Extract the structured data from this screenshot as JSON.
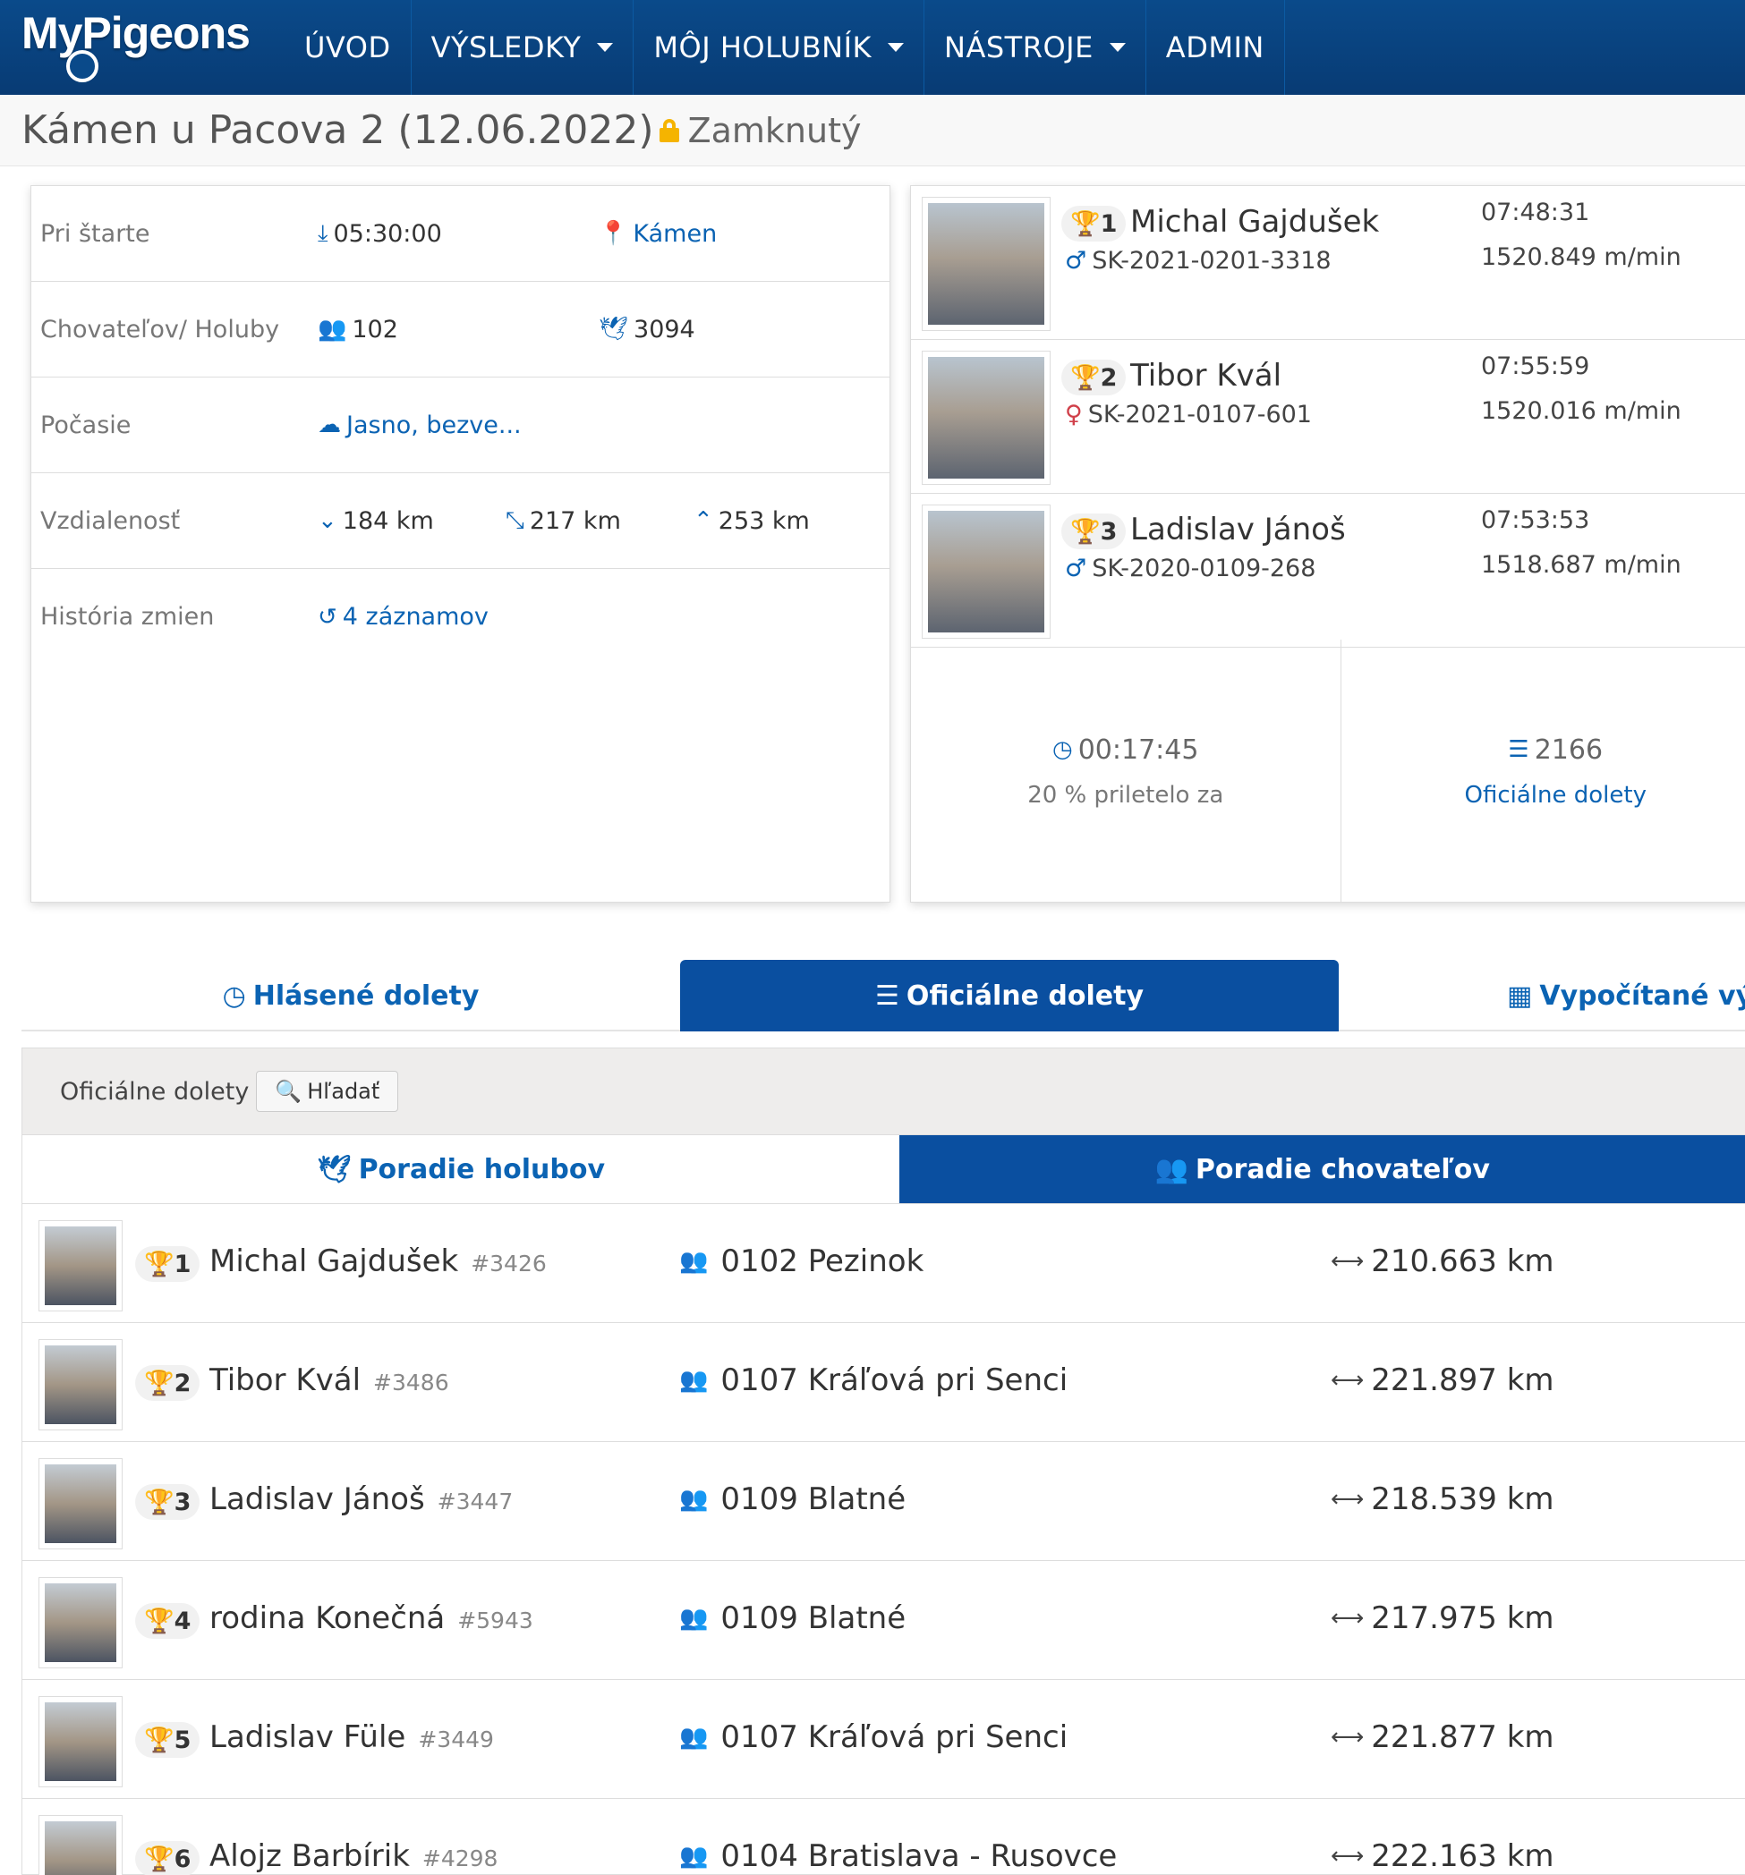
{
  "brand": {
    "logo_text": "MyPigeons"
  },
  "nav": {
    "items": [
      {
        "label": "ÚVOD"
      },
      {
        "label": "VÝSLEDKY"
      },
      {
        "label": "MÔJ HOLUBNÍK"
      },
      {
        "label": "NÁSTROJE"
      },
      {
        "label": "ADMIN"
      }
    ]
  },
  "race": {
    "title": "Kámen u Pacova 2 (12.06.2022)",
    "status": "Zamknutý"
  },
  "info": {
    "start_label": "Pri štarte",
    "start_time": "05:30:00",
    "start_place": "Kámen",
    "breeders_label": "Chovateľov/ Holuby",
    "breeders": "102",
    "pigeons": "3094",
    "weather_label": "Počasie",
    "weather": "Jasno, bezve...",
    "distance_label": "Vzdialenosť",
    "dist_min": "184 km",
    "dist_avg": "217 km",
    "dist_max": "253 km",
    "history_label": "História zmien",
    "history": "4 záznamov"
  },
  "winners": [
    {
      "rank": "1",
      "name": "Michal Gajdušek",
      "sex": "♂",
      "ring": "SK-2021-0201-3318",
      "time": "07:48:31",
      "speed": "1520.849 m/min"
    },
    {
      "rank": "2",
      "name": "Tibor Kvál",
      "sex": "♀",
      "ring": "SK-2021-0107-601",
      "time": "07:55:59",
      "speed": "1520.016 m/min"
    },
    {
      "rank": "3",
      "name": "Ladislav Jánoš",
      "sex": "♂",
      "ring": "SK-2020-0109-268",
      "time": "07:53:53",
      "speed": "1518.687 m/min"
    }
  ],
  "stats": {
    "arrival_time": "00:17:45",
    "arrival_label": "20 % priletelo za",
    "official_count": "2166",
    "official_label": "Oficiálne dolety"
  },
  "main_tabs": [
    {
      "label": "Hlásené dolety"
    },
    {
      "label": "Oficiálne dolety"
    },
    {
      "label": "Vypočítané výsl"
    }
  ],
  "panel": {
    "heading": "Oficiálne dolety",
    "search_label": "Hľadať",
    "sub_tabs": [
      {
        "label": "Poradie holubov"
      },
      {
        "label": "Poradie chovateľov"
      }
    ]
  },
  "ranking": [
    {
      "rank": "1",
      "name": "Michal Gajdušek",
      "id": "#3426",
      "club": "0102 Pezinok",
      "distance": "210.663 km"
    },
    {
      "rank": "2",
      "name": "Tibor Kvál",
      "id": "#3486",
      "club": "0107 Kráľová pri Senci",
      "distance": "221.897 km"
    },
    {
      "rank": "3",
      "name": "Ladislav Jánoš",
      "id": "#3447",
      "club": "0109 Blatné",
      "distance": "218.539 km"
    },
    {
      "rank": "4",
      "name": "rodina Konečná",
      "id": "#5943",
      "club": "0109 Blatné",
      "distance": "217.975 km"
    },
    {
      "rank": "5",
      "name": "Ladislav Füle",
      "id": "#3449",
      "club": "0107 Kráľová pri Senci",
      "distance": "221.877 km"
    },
    {
      "rank": "6",
      "name": "Alojz Barbírik",
      "id": "#4298",
      "club": "0104 Bratislava - Rusovce",
      "distance": "222.163 km"
    }
  ],
  "colors": {
    "primary": "#0a4fa0",
    "link": "#0b63b3",
    "lock": "#f5b400",
    "female": "#d0404a"
  }
}
